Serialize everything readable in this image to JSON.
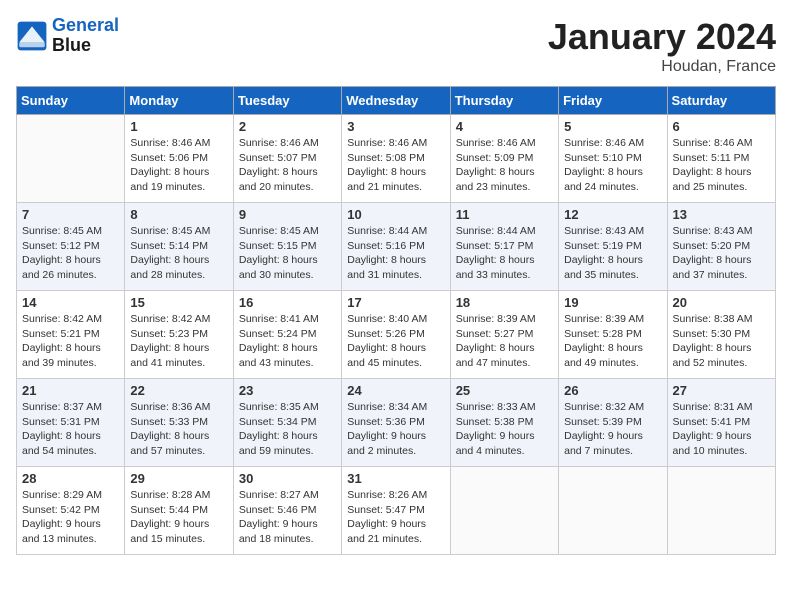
{
  "header": {
    "logo_line1": "General",
    "logo_line2": "Blue",
    "month": "January 2024",
    "location": "Houdan, France"
  },
  "weekdays": [
    "Sunday",
    "Monday",
    "Tuesday",
    "Wednesday",
    "Thursday",
    "Friday",
    "Saturday"
  ],
  "weeks": [
    [
      {
        "day": "",
        "info": ""
      },
      {
        "day": "1",
        "info": "Sunrise: 8:46 AM\nSunset: 5:06 PM\nDaylight: 8 hours\nand 19 minutes."
      },
      {
        "day": "2",
        "info": "Sunrise: 8:46 AM\nSunset: 5:07 PM\nDaylight: 8 hours\nand 20 minutes."
      },
      {
        "day": "3",
        "info": "Sunrise: 8:46 AM\nSunset: 5:08 PM\nDaylight: 8 hours\nand 21 minutes."
      },
      {
        "day": "4",
        "info": "Sunrise: 8:46 AM\nSunset: 5:09 PM\nDaylight: 8 hours\nand 23 minutes."
      },
      {
        "day": "5",
        "info": "Sunrise: 8:46 AM\nSunset: 5:10 PM\nDaylight: 8 hours\nand 24 minutes."
      },
      {
        "day": "6",
        "info": "Sunrise: 8:46 AM\nSunset: 5:11 PM\nDaylight: 8 hours\nand 25 minutes."
      }
    ],
    [
      {
        "day": "7",
        "info": "Sunrise: 8:45 AM\nSunset: 5:12 PM\nDaylight: 8 hours\nand 26 minutes."
      },
      {
        "day": "8",
        "info": "Sunrise: 8:45 AM\nSunset: 5:14 PM\nDaylight: 8 hours\nand 28 minutes."
      },
      {
        "day": "9",
        "info": "Sunrise: 8:45 AM\nSunset: 5:15 PM\nDaylight: 8 hours\nand 30 minutes."
      },
      {
        "day": "10",
        "info": "Sunrise: 8:44 AM\nSunset: 5:16 PM\nDaylight: 8 hours\nand 31 minutes."
      },
      {
        "day": "11",
        "info": "Sunrise: 8:44 AM\nSunset: 5:17 PM\nDaylight: 8 hours\nand 33 minutes."
      },
      {
        "day": "12",
        "info": "Sunrise: 8:43 AM\nSunset: 5:19 PM\nDaylight: 8 hours\nand 35 minutes."
      },
      {
        "day": "13",
        "info": "Sunrise: 8:43 AM\nSunset: 5:20 PM\nDaylight: 8 hours\nand 37 minutes."
      }
    ],
    [
      {
        "day": "14",
        "info": "Sunrise: 8:42 AM\nSunset: 5:21 PM\nDaylight: 8 hours\nand 39 minutes."
      },
      {
        "day": "15",
        "info": "Sunrise: 8:42 AM\nSunset: 5:23 PM\nDaylight: 8 hours\nand 41 minutes."
      },
      {
        "day": "16",
        "info": "Sunrise: 8:41 AM\nSunset: 5:24 PM\nDaylight: 8 hours\nand 43 minutes."
      },
      {
        "day": "17",
        "info": "Sunrise: 8:40 AM\nSunset: 5:26 PM\nDaylight: 8 hours\nand 45 minutes."
      },
      {
        "day": "18",
        "info": "Sunrise: 8:39 AM\nSunset: 5:27 PM\nDaylight: 8 hours\nand 47 minutes."
      },
      {
        "day": "19",
        "info": "Sunrise: 8:39 AM\nSunset: 5:28 PM\nDaylight: 8 hours\nand 49 minutes."
      },
      {
        "day": "20",
        "info": "Sunrise: 8:38 AM\nSunset: 5:30 PM\nDaylight: 8 hours\nand 52 minutes."
      }
    ],
    [
      {
        "day": "21",
        "info": "Sunrise: 8:37 AM\nSunset: 5:31 PM\nDaylight: 8 hours\nand 54 minutes."
      },
      {
        "day": "22",
        "info": "Sunrise: 8:36 AM\nSunset: 5:33 PM\nDaylight: 8 hours\nand 57 minutes."
      },
      {
        "day": "23",
        "info": "Sunrise: 8:35 AM\nSunset: 5:34 PM\nDaylight: 8 hours\nand 59 minutes."
      },
      {
        "day": "24",
        "info": "Sunrise: 8:34 AM\nSunset: 5:36 PM\nDaylight: 9 hours\nand 2 minutes."
      },
      {
        "day": "25",
        "info": "Sunrise: 8:33 AM\nSunset: 5:38 PM\nDaylight: 9 hours\nand 4 minutes."
      },
      {
        "day": "26",
        "info": "Sunrise: 8:32 AM\nSunset: 5:39 PM\nDaylight: 9 hours\nand 7 minutes."
      },
      {
        "day": "27",
        "info": "Sunrise: 8:31 AM\nSunset: 5:41 PM\nDaylight: 9 hours\nand 10 minutes."
      }
    ],
    [
      {
        "day": "28",
        "info": "Sunrise: 8:29 AM\nSunset: 5:42 PM\nDaylight: 9 hours\nand 13 minutes."
      },
      {
        "day": "29",
        "info": "Sunrise: 8:28 AM\nSunset: 5:44 PM\nDaylight: 9 hours\nand 15 minutes."
      },
      {
        "day": "30",
        "info": "Sunrise: 8:27 AM\nSunset: 5:46 PM\nDaylight: 9 hours\nand 18 minutes."
      },
      {
        "day": "31",
        "info": "Sunrise: 8:26 AM\nSunset: 5:47 PM\nDaylight: 9 hours\nand 21 minutes."
      },
      {
        "day": "",
        "info": ""
      },
      {
        "day": "",
        "info": ""
      },
      {
        "day": "",
        "info": ""
      }
    ]
  ]
}
